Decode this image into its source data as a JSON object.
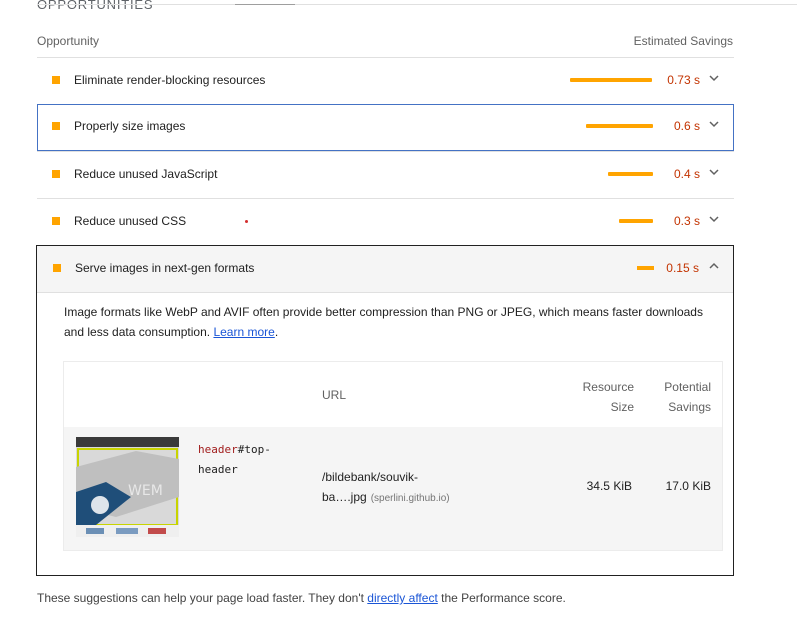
{
  "section": {
    "title": "OPPORTUNITIES"
  },
  "columns": {
    "opportunity": "Opportunity",
    "savings": "Estimated Savings"
  },
  "audits": [
    {
      "title": "Eliminate render-blocking resources",
      "value": "0.73 s",
      "savings_fraction": 1.0
    },
    {
      "title": "Properly size images",
      "value": "0.6 s",
      "savings_fraction": 0.82
    },
    {
      "title": "Reduce unused JavaScript",
      "value": "0.4 s",
      "savings_fraction": 0.55
    },
    {
      "title": "Reduce unused CSS",
      "value": "0.3 s",
      "savings_fraction": 0.41
    }
  ],
  "expanded": {
    "title": "Serve images in next-gen formats",
    "value": "0.15 s",
    "savings_fraction": 0.21,
    "description": "Image formats like WebP and AVIF often provide better compression than PNG or JPEG, which means faster downloads and less data consumption.",
    "learn_more": "Learn more",
    "table": {
      "headers": {
        "url": "URL",
        "resource_size_1": "Resource",
        "resource_size_2": "Size",
        "potential_savings_1": "Potential",
        "potential_savings_2": "Savings"
      },
      "rows": [
        {
          "node_tag": "header",
          "node_rest_1": "#top-",
          "node_rest_2": "header",
          "url_1": "/bildebank/souvik-",
          "url_2": "ba….jpg",
          "origin": "(sperlini.github.io)",
          "resource_size": "34.5 KiB",
          "potential_savings": "17.0 KiB"
        }
      ]
    }
  },
  "footer": {
    "before": "These suggestions can help your page load faster. They don't ",
    "link": "directly affect",
    "after": " the Performance score."
  },
  "colors": {
    "accent": "#ffa400",
    "value": "#c33300",
    "link": "#1a55d6",
    "selection": "#4472c4"
  }
}
